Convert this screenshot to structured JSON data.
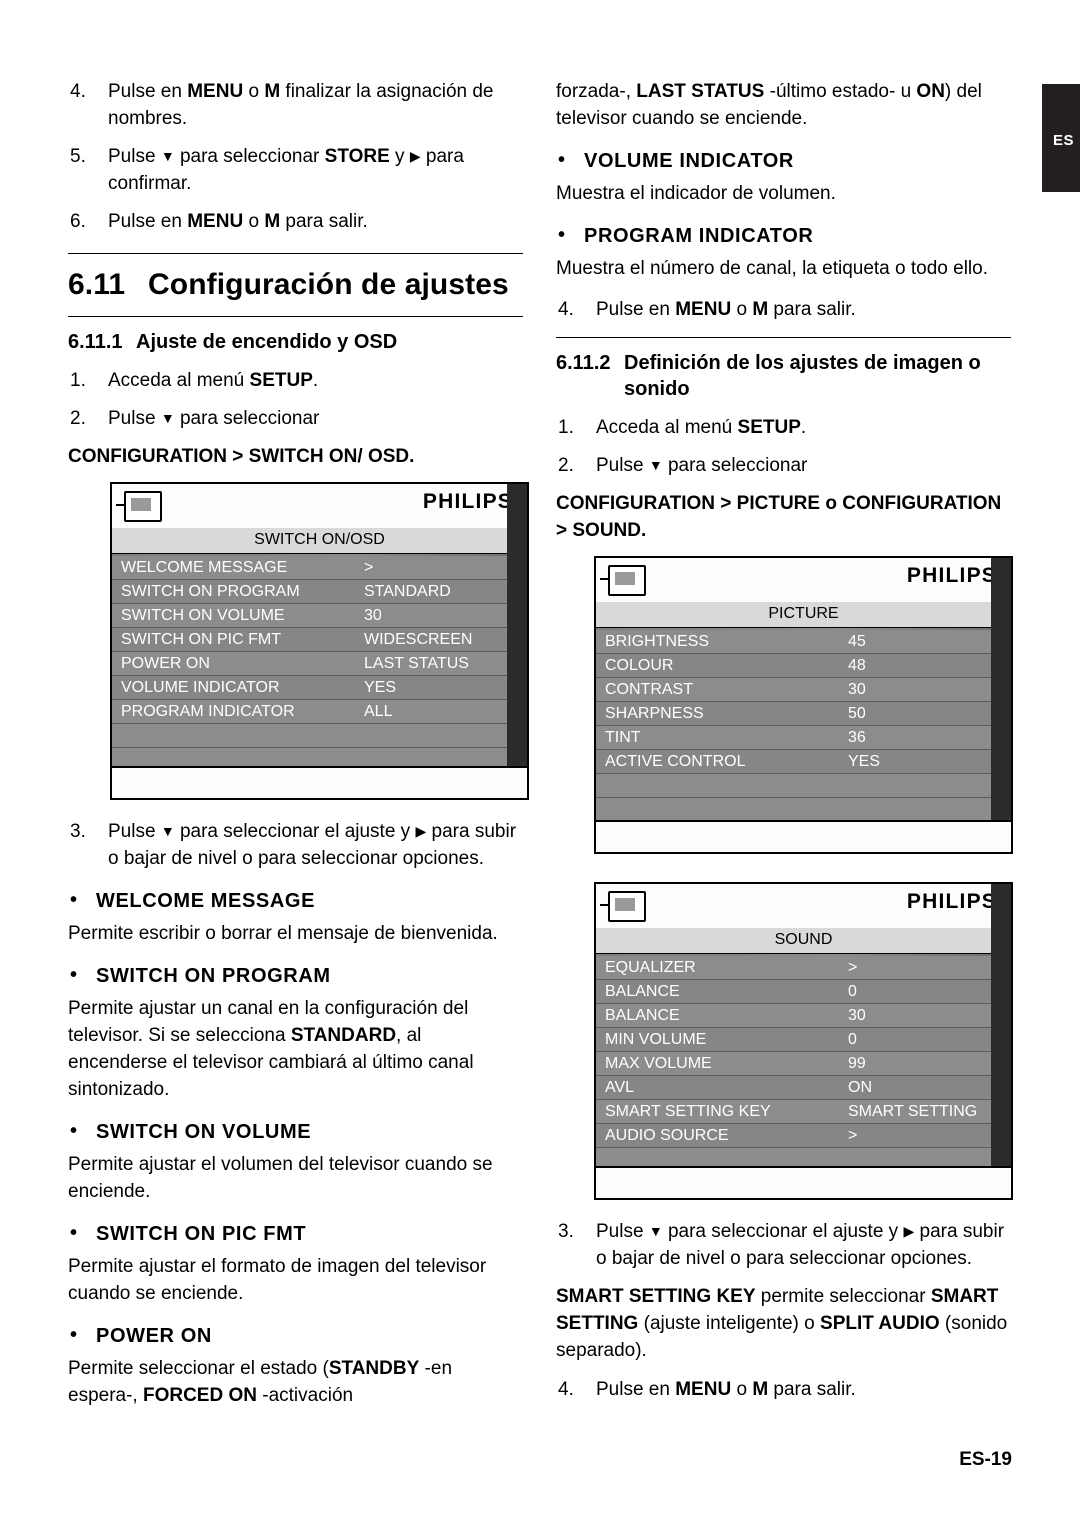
{
  "side_tab": {
    "label": "ES"
  },
  "page_footer": {
    "label": "ES-19"
  },
  "left": {
    "steps_top": [
      {
        "num": "4.",
        "parts": [
          {
            "t": "Pulse en ",
            "b": false
          },
          {
            "t": "MENU",
            "b": true
          },
          {
            "t": " o ",
            "b": false
          },
          {
            "t": "M",
            "b": true
          },
          {
            "t": " finalizar la asignación de nombres.",
            "b": false
          }
        ]
      },
      {
        "num": "5.",
        "parts": [
          {
            "t": "Pulse ",
            "b": false
          },
          {
            "t": "▼",
            "b": false
          },
          {
            "t": " para seleccionar ",
            "b": false
          },
          {
            "t": "STORE",
            "b": true
          },
          {
            "t": " y ",
            "b": false
          },
          {
            "t": "▶",
            "b": false
          },
          {
            "t": " para confirmar.",
            "b": false
          }
        ]
      },
      {
        "num": "6.",
        "parts": [
          {
            "t": "Pulse en ",
            "b": false
          },
          {
            "t": "MENU",
            "b": true
          },
          {
            "t": " o ",
            "b": false
          },
          {
            "t": "M",
            "b": true
          },
          {
            "t": " para salir.",
            "b": false
          }
        ]
      }
    ],
    "section": {
      "number": "6.11",
      "title": "Configuración de ajustes"
    },
    "subsection": {
      "number": "6.11.1",
      "title": "Ajuste de encendido y OSD"
    },
    "steps_mid": [
      {
        "num": "1.",
        "parts": [
          {
            "t": "Acceda al menú ",
            "b": false
          },
          {
            "t": "SETUP",
            "b": true
          },
          {
            "t": ".",
            "b": false
          }
        ]
      },
      {
        "num": "2.",
        "parts": [
          {
            "t": "Pulse ",
            "b": false
          },
          {
            "t": "▼",
            "b": false
          },
          {
            "t": " para seleccionar",
            "b": false
          }
        ]
      }
    ],
    "path_bold": "CONFIGURATION > SWITCH ON/ OSD.",
    "osd": {
      "brand": "PHILIPS",
      "title": "SWITCH ON/OSD",
      "rows": [
        {
          "label": "WELCOME MESSAGE",
          "value": ">"
        },
        {
          "label": "SWITCH ON PROGRAM",
          "value": "STANDARD"
        },
        {
          "label": "SWITCH ON VOLUME",
          "value": "30"
        },
        {
          "label": "SWITCH ON PIC FMT",
          "value": "WIDESCREEN"
        },
        {
          "label": "POWER ON",
          "value": "LAST STATUS"
        },
        {
          "label": "VOLUME INDICATOR",
          "value": "YES"
        },
        {
          "label": "PROGRAM INDICATOR",
          "value": "ALL"
        }
      ]
    },
    "step3": {
      "num": "3.",
      "parts": [
        {
          "t": "Pulse ",
          "b": false
        },
        {
          "t": "▼",
          "b": false
        },
        {
          "t": " para seleccionar el ajuste y ",
          "b": false
        },
        {
          "t": "▶",
          "b": false
        },
        {
          "t": " para subir o bajar de nivel o para seleccionar opciones.",
          "b": false
        }
      ]
    },
    "bullets": [
      {
        "head": "WELCOME MESSAGE",
        "body": "Permite escribir o borrar el mensaje de bienvenida."
      },
      {
        "head": "SWITCH ON PROGRAM",
        "body_html": "Permite ajustar un canal en la configuración del televisor. Si se selecciona <b>STANDARD</b>, al encenderse el televisor cambiará al último canal sintonizado."
      },
      {
        "head": "SWITCH ON VOLUME",
        "body": "Permite ajustar el volumen del televisor cuando se enciende."
      },
      {
        "head": "SWITCH ON PIC FMT",
        "body": "Permite ajustar el formato de imagen del televisor cuando se enciende."
      },
      {
        "head": "POWER ON",
        "body_html": "Permite seleccionar el estado (<b>STANDBY</b> -en espera-, <b>FORCED ON</b> -activación"
      }
    ]
  },
  "right": {
    "continuation_html": "forzada-, <b>LAST STATUS</b> -último estado- u <b>ON</b>) del televisor cuando se enciende.",
    "bullets_top": [
      {
        "head": "VOLUME INDICATOR",
        "body": "Muestra el indicador de volumen."
      },
      {
        "head": "PROGRAM INDICATOR",
        "body": "Muestra el número de canal, la etiqueta o todo ello."
      }
    ],
    "step4": {
      "num": "4.",
      "parts": [
        {
          "t": "Pulse en ",
          "b": false
        },
        {
          "t": "MENU",
          "b": true
        },
        {
          "t": " o ",
          "b": false
        },
        {
          "t": "M",
          "b": true
        },
        {
          "t": " para salir.",
          "b": false
        }
      ]
    },
    "subsection": {
      "number": "6.11.2",
      "title": "Definición de los ajustes de imagen o sonido"
    },
    "steps": [
      {
        "num": "1.",
        "parts": [
          {
            "t": "Acceda al menú ",
            "b": false
          },
          {
            "t": "SETUP",
            "b": true
          },
          {
            "t": ".",
            "b": false
          }
        ]
      },
      {
        "num": "2.",
        "parts": [
          {
            "t": "Pulse ",
            "b": false
          },
          {
            "t": "▼",
            "b": false
          },
          {
            "t": " para seleccionar",
            "b": false
          }
        ]
      }
    ],
    "path_bold_html": "<b>CONFIGURATION > PICTURE</b> o <b>CONFIGURATION > SOUND</b>.",
    "osd_picture": {
      "brand": "PHILIPS",
      "title": "PICTURE",
      "rows": [
        {
          "label": "BRIGHTNESS",
          "value": "45"
        },
        {
          "label": "COLOUR",
          "value": "48"
        },
        {
          "label": "CONTRAST",
          "value": "30"
        },
        {
          "label": "SHARPNESS",
          "value": "50"
        },
        {
          "label": "TINT",
          "value": "36"
        },
        {
          "label": "ACTIVE CONTROL",
          "value": "YES"
        }
      ]
    },
    "osd_sound": {
      "brand": "PHILIPS",
      "title": "SOUND",
      "rows": [
        {
          "label": "EQUALIZER",
          "value": ">"
        },
        {
          "label": "BALANCE",
          "value": "0"
        },
        {
          "label": "BALANCE",
          "value": "30"
        },
        {
          "label": "MIN VOLUME",
          "value": "0"
        },
        {
          "label": "MAX VOLUME",
          "value": "99"
        },
        {
          "label": "AVL",
          "value": "ON"
        },
        {
          "label": "SMART SETTING KEY",
          "value": "SMART SETTING"
        },
        {
          "label": "AUDIO SOURCE",
          "value": ">"
        }
      ]
    },
    "step3": {
      "num": "3.",
      "parts": [
        {
          "t": "Pulse ",
          "b": false
        },
        {
          "t": "▼",
          "b": false
        },
        {
          "t": " para seleccionar el ajuste y ",
          "b": false
        },
        {
          "t": "▶",
          "b": false
        },
        {
          "t": " para subir o bajar de nivel o para seleccionar opciones.",
          "b": false
        }
      ]
    },
    "smart_note_html": "<b>SMART SETTING KEY</b> permite seleccionar <b>SMART SETTING</b> (ajuste inteligente) o <b>SPLIT AUDIO</b> (sonido separado).",
    "step4b": {
      "num": "4.",
      "parts": [
        {
          "t": "Pulse en ",
          "b": false
        },
        {
          "t": "MENU",
          "b": true
        },
        {
          "t": " o ",
          "b": false
        },
        {
          "t": "M",
          "b": true
        },
        {
          "t": " para salir.",
          "b": false
        }
      ]
    }
  }
}
